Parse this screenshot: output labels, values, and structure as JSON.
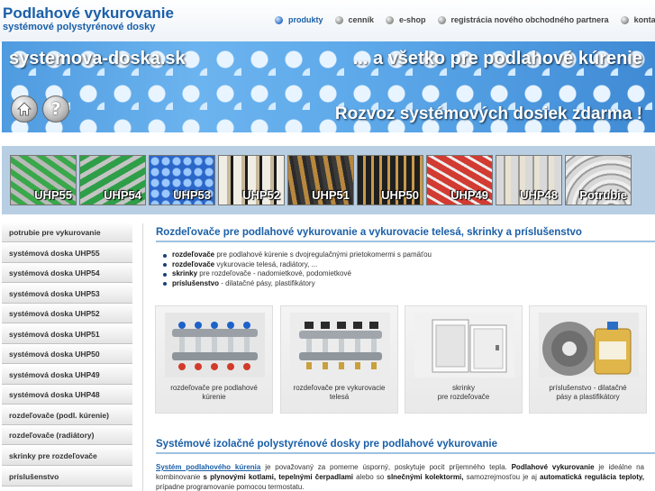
{
  "header": {
    "title": "Podlahové vykurovanie",
    "subtitle": "systémové polystyrénové dosky"
  },
  "nav": [
    {
      "label": "produkty",
      "active": true
    },
    {
      "label": "cenník",
      "active": false
    },
    {
      "label": "e-shop",
      "active": false
    },
    {
      "label": "registrácia nového obchodného partnera",
      "active": false
    },
    {
      "label": "kontakt",
      "active": false
    }
  ],
  "banner": {
    "domain": "systemova-doska.sk",
    "slogan": "... a všetko pre podlahové kúrenie",
    "delivery": "Rozvoz systémových dosiek zdarma !",
    "help_symbol": "?"
  },
  "products": [
    "UHP55",
    "UHP54",
    "UHP53",
    "UHP52",
    "UHP51",
    "UHP50",
    "UHP49",
    "UHP48",
    "Potrubie"
  ],
  "sidebar": [
    "potrubie pre vykurovanie",
    "systémová doska UHP55",
    "systémová doska UHP54",
    "systémová doska UHP53",
    "systémová doska UHP52",
    "systémová doska UHP51",
    "systémová doska UHP50",
    "systémová doska UHP49",
    "systémová doska UHP48",
    "rozdeľovače (podl. kúrenie)",
    "rozdeľovače (radiátory)",
    "skrinky pre rozdeľovače",
    "príslušenstvo"
  ],
  "main": {
    "heading": "Rozdeľovače pre podlahové vykurovanie a vykurovacie telesá, skrinky a príslušenstvo",
    "features": [
      {
        "bold": "rozdeľovače",
        "text": " pre podlahové kúrenie s dvojregulačnými prietokomermi s pamäťou"
      },
      {
        "bold": "rozdeľovače",
        "text": " vykurovacie telesá, radiátory, ..."
      },
      {
        "bold": "skrinky",
        "text": " pre rozdeľovače - nadomietkové, podomietkové"
      },
      {
        "bold": "príslušenstvo",
        "text": " - dilatačné pásy, plastifikátory"
      }
    ],
    "cards": [
      {
        "line1": "rozdeľovače pre podlahové",
        "line2": "kúrenie"
      },
      {
        "line1": "rozdeľovače pre vykurovacie",
        "line2": "telesá"
      },
      {
        "line1": "skrinky",
        "line2": "pre rozdeľovače"
      },
      {
        "line1": "príslušenstvo - dilatačné",
        "line2": "pásy a plastifikátory"
      }
    ],
    "heading2": "Systémové izolačné polystyrénové dosky pre podlahové vykurovanie",
    "paragraph": {
      "link": "Systém podlahového kúrenia",
      "t1": " je považovaný za pomerne úsporný, poskytuje pocit príjemného tepla. ",
      "b1": "Podlahové vykurovanie",
      "t2": " je ideálne na kombinovanie ",
      "b2": "s plynovými kotlami, tepelnými čerpadlami",
      "t3": " alebo so ",
      "b3": "slnečnými kolektormi,",
      "t4": " samozrejmosťou je aj ",
      "b4": "automatická regulácia teploty,",
      "t5": " prípadne programovanie pomocou termostatu."
    }
  },
  "colors": {
    "accent": "#1a5fa8",
    "product_strip": "#b8cfe3",
    "banner": "#5aa6e8"
  }
}
